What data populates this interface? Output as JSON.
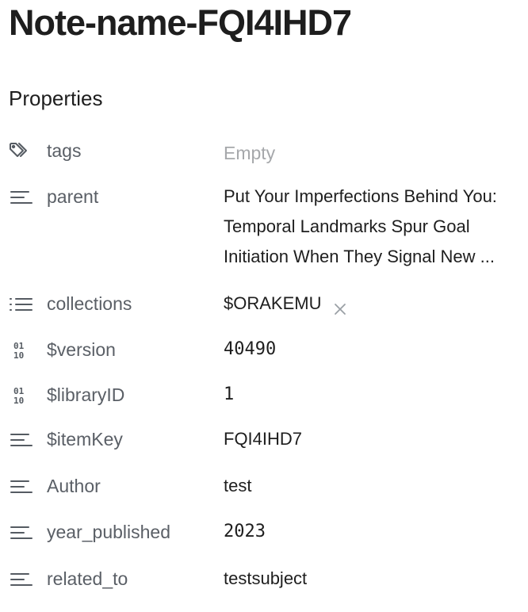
{
  "note": {
    "title": "Note-name-FQI4IHD7"
  },
  "properties": {
    "heading": "Properties",
    "rows": [
      {
        "key": "tags",
        "icon": "tags-icon",
        "value": "Empty"
      },
      {
        "key": "parent",
        "icon": "text-icon",
        "value_lines": [
          "Put Your Imperfections Behind You:",
          "Temporal Landmarks Spur Goal",
          "Initiation When They Signal New ..."
        ]
      },
      {
        "key": "collections",
        "icon": "list-icon",
        "value": "$ORAKEMU"
      },
      {
        "key": "$version",
        "icon": "number-icon",
        "value": "40490"
      },
      {
        "key": "$libraryID",
        "icon": "number-icon",
        "value": "1"
      },
      {
        "key": "$itemKey",
        "icon": "text-icon",
        "value": "FQI4IHD7"
      },
      {
        "key": "Author",
        "icon": "text-icon",
        "value": "test"
      },
      {
        "key": "year_published",
        "icon": "text-icon",
        "value": "2023"
      },
      {
        "key": "related_to",
        "icon": "text-icon",
        "value": "testsubject"
      }
    ]
  },
  "icons": {
    "number_icon_top": "01",
    "number_icon_bottom": "10",
    "remove_symbol": "×"
  },
  "colors": {
    "text": "#1e1e1e",
    "key": "#5a5f66",
    "muted": "#a6a8ab",
    "icon": "#555b62"
  }
}
